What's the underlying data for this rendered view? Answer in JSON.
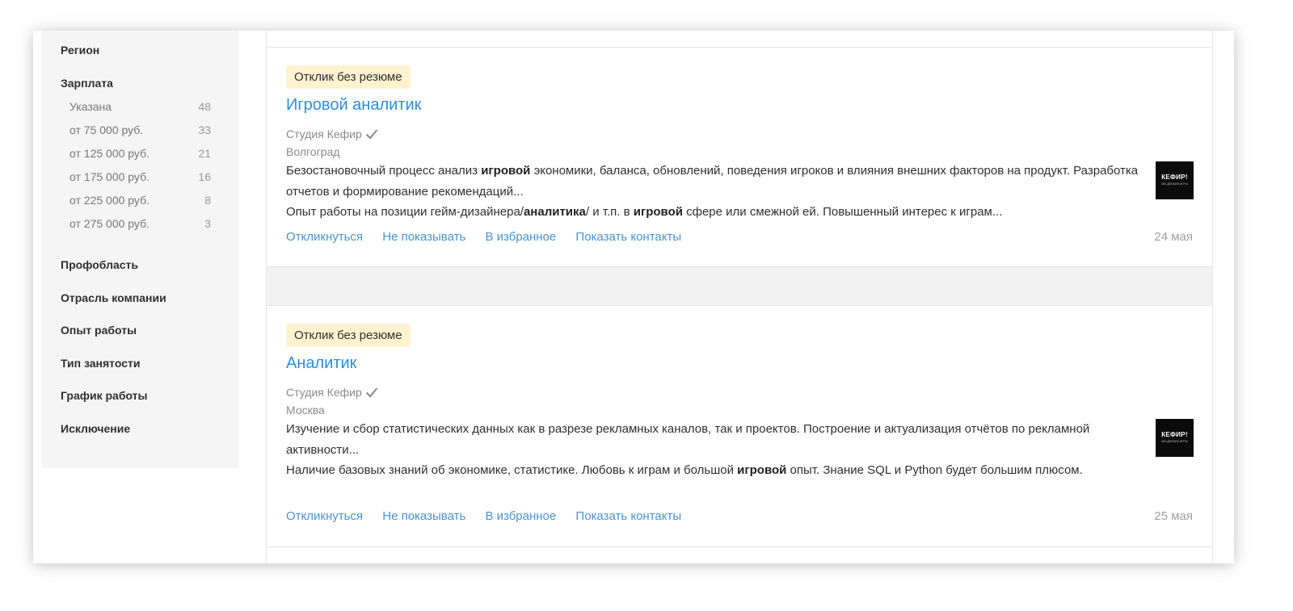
{
  "sidebar": {
    "region_heading": "Регион",
    "salary_heading": "Зарплата",
    "salary_options": [
      {
        "label": "Указана",
        "count": "48"
      },
      {
        "label": "от 75 000 руб.",
        "count": "33"
      },
      {
        "label": "от 125 000 руб.",
        "count": "21"
      },
      {
        "label": "от 175 000 руб.",
        "count": "16"
      },
      {
        "label": "от 225 000 руб.",
        "count": "8"
      },
      {
        "label": "от 275 000 руб.",
        "count": "3"
      }
    ],
    "headings": [
      "Профобласть",
      "Отрасль компании",
      "Опыт работы",
      "Тип занятости",
      "График работы",
      "Исключение"
    ]
  },
  "vacancies": [
    {
      "badge": "Отклик без резюме",
      "title": "Игровой аналитик",
      "employer": "Студия Кефир",
      "city": "Волгоград",
      "logo_main": "КЕФИР!",
      "logo_sub": "МЫ ДЕЛАЕМ ИГРЫ",
      "desc1": [
        "Безостановочный процесс анализ ",
        "игровой",
        " экономики, баланса, обновлений, поведения игроков и влияния внешних факторов на продукт. Разработка отчетов и формирование рекомендаций..."
      ],
      "desc2": [
        "Опыт работы на позиции гейм-дизайнера/",
        "аналитика",
        "/ и т.п. в ",
        "игровой",
        " сфере или смежной ей. Повышенный интерес к играм..."
      ],
      "actions": [
        "Откликнуться",
        "Не показывать",
        "В избранное",
        "Показать контакты"
      ],
      "date": "24 мая"
    },
    {
      "badge": "Отклик без резюме",
      "title": "Аналитик",
      "employer": "Студия Кефир",
      "city": "Москва",
      "logo_main": "КЕФИР!",
      "logo_sub": "МЫ ДЕЛАЕМ ИГРЫ",
      "desc1": [
        "Изучение и сбор статистических данных как в разрезе рекламных каналов, так и проектов. Построение и актуализация отчётов по рекламной активности..."
      ],
      "desc2": [
        "Наличие базовых знаний об экономике, статистике. Любовь к играм и большой ",
        "игровой",
        " опыт. Знание SQL и Python будет большим плюсом."
      ],
      "actions": [
        "Откликнуться",
        "Не показывать",
        "В избранное",
        "Показать контакты"
      ],
      "date": "25 мая"
    }
  ],
  "colors": {
    "link": "#2d8fd6",
    "badge_bg": "#fff3cf",
    "sidebar_bg": "#f5f5f5",
    "gap_bg": "#f2f2f2"
  }
}
